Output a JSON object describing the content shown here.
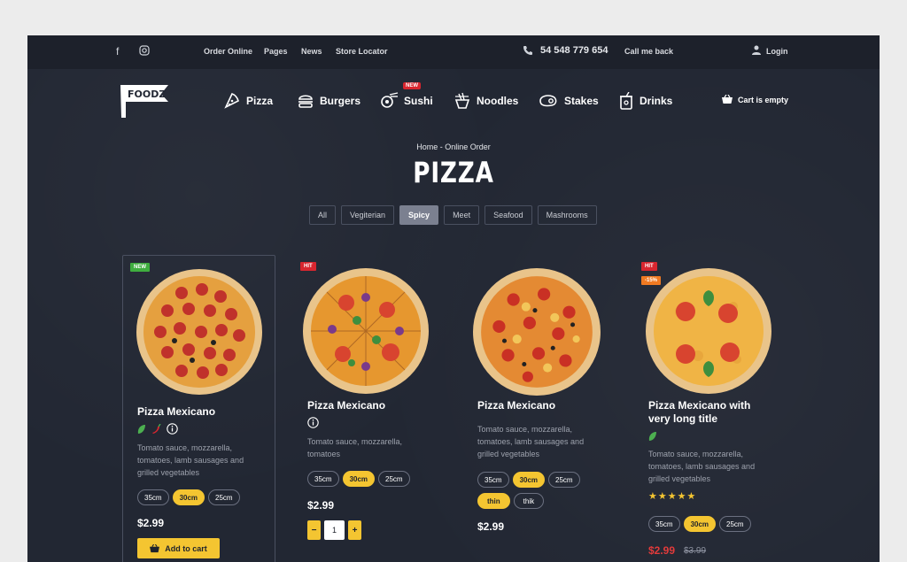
{
  "topbar": {
    "links": [
      "Order Online",
      "Pages",
      "News",
      "Store Locator"
    ],
    "phone": "54 548 779 654",
    "callback": "Call me back",
    "login": "Login"
  },
  "brand": {
    "logo_text": "FOODZ"
  },
  "nav": {
    "items": [
      {
        "label": "Pizza",
        "icon": "pizza-icon"
      },
      {
        "label": "Burgers",
        "icon": "burger-icon"
      },
      {
        "label": "Sushi",
        "icon": "sushi-icon",
        "badge": "NEW"
      },
      {
        "label": "Noodles",
        "icon": "noodles-icon"
      },
      {
        "label": "Stakes",
        "icon": "steak-icon"
      },
      {
        "label": "Drinks",
        "icon": "drink-icon"
      }
    ],
    "cart": "Cart is empty"
  },
  "hero": {
    "breadcrumb": "Home  -  Online Order",
    "title": "PIZZA"
  },
  "filters": {
    "items": [
      "All",
      "Vegiterian",
      "Spicy",
      "Meet",
      "Seafood",
      "Mashrooms"
    ],
    "active": "Spicy"
  },
  "products": [
    {
      "badge": "NEW",
      "name": "Pizza Mexicano",
      "desc": [
        "Tomato sauce, mozzarella,",
        "tomatoes, lamb sausages and",
        "grilled vegetables"
      ],
      "sizes": [
        "35cm",
        "30cm",
        "25cm"
      ],
      "selected_size": "30cm",
      "price": "$2.99",
      "add_to_cart": "Add to cart"
    },
    {
      "badge": "HIT",
      "name": "Pizza Mexicano",
      "desc": [
        "Tomato sauce, mozzarella,",
        "tomatoes"
      ],
      "sizes": [
        "35cm",
        "30cm",
        "25cm"
      ],
      "selected_size": "30cm",
      "price": "$2.99",
      "quantity": "1",
      "minus": "−",
      "plus": "+"
    },
    {
      "name": "Pizza Mexicano",
      "desc": [
        "Tomato sauce, mozzarella,",
        "tomatoes, lamb sausages and",
        "grilled vegetables"
      ],
      "sizes": [
        "35cm",
        "30cm",
        "25cm"
      ],
      "selected_size": "30cm",
      "crusts": [
        "thin",
        "thik"
      ],
      "selected_crust": "thin",
      "price": "$2.99"
    },
    {
      "badge": "HIT",
      "discount": "-15%",
      "name": [
        "Pizza Mexicano with",
        "very long title"
      ],
      "desc": [
        "Tomato sauce, mozzarella,",
        "tomatoes, lamb sausages and",
        "grilled vegetables"
      ],
      "rating": "★★★★★",
      "sizes": [
        "35cm",
        "30cm",
        "25cm"
      ],
      "selected_size": "30cm",
      "price": "$2.99",
      "old_price": "$3.99"
    }
  ],
  "colors": {
    "background": "#222733",
    "accent": "#f4c531",
    "badge_new": "#3fae3f",
    "badge_hit": "#d8262f",
    "badge_discount": "#f07a22",
    "sale_price": "#e23b3b"
  }
}
